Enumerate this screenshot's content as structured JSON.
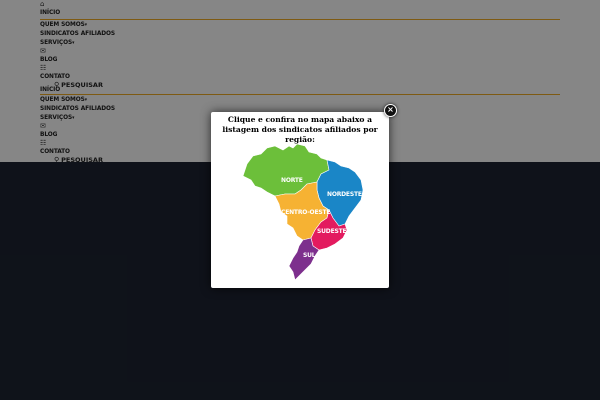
{
  "nav": {
    "primary": {
      "home_icon": "home-icon",
      "items": [
        "INÍCIO",
        "QUEM SOMOS",
        "SINDICATOS AFILIADOS",
        "SERVIÇOS",
        "BLOG",
        "CONTATO"
      ],
      "search_label": "PESQUISAR"
    },
    "secondary": {
      "items": [
        "INÍCIO",
        "QUEM SOMOS",
        "SINDICATOS AFILIADOS",
        "SERVIÇOS",
        "BLOG",
        "CONTATO"
      ],
      "search_label": "PESQUISAR"
    },
    "caret": "▾",
    "mail_icon": "mail-icon",
    "blog_icon": "rss-icon",
    "search_icon": "search-icon"
  },
  "modal": {
    "text": "Clique e confira no mapa abaixo a listagem dos sindicatos afiliados por região:",
    "close_label": "×",
    "regions": {
      "norte": "NORTE",
      "nordeste": "NORDESTE",
      "centro_oeste": "CENTRO-OESTE",
      "sudeste": "SUDESTE",
      "sul": "SUL"
    },
    "colors": {
      "norte": "#6cbf3a",
      "nordeste": "#1a86c7",
      "centro_oeste": "#f6b233",
      "sudeste": "#e31b5f",
      "sul": "#7d2f8d"
    }
  },
  "colors": {
    "accent_line": "#e5a521",
    "dark_bg": "#1c2230"
  }
}
